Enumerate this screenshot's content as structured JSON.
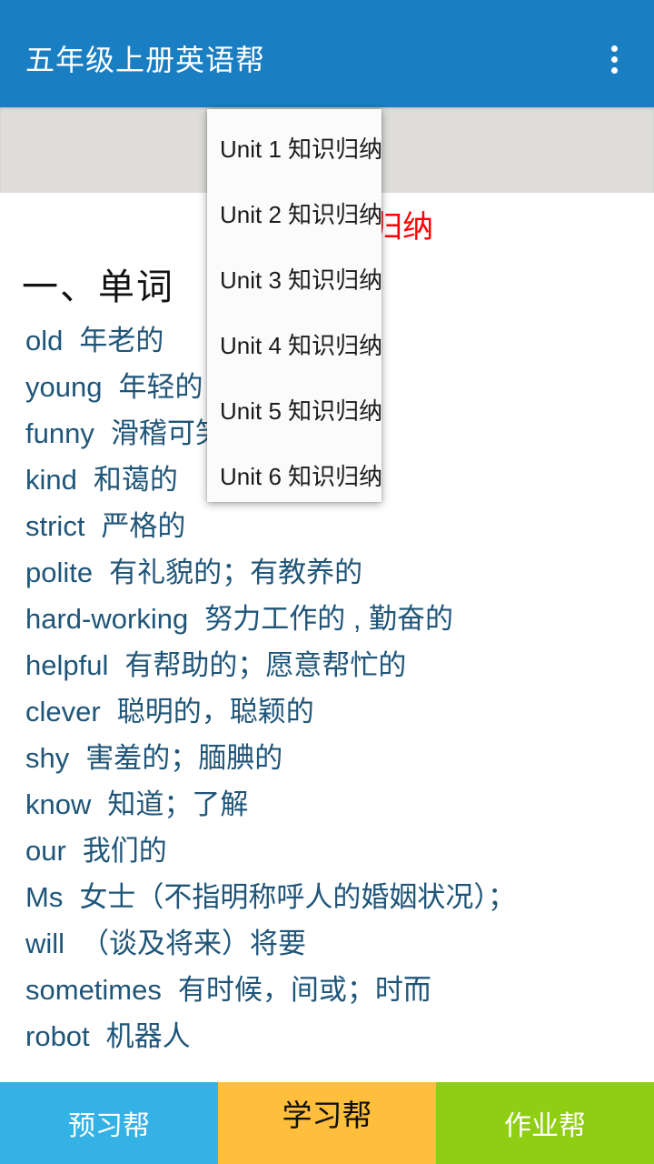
{
  "app_bar": {
    "title": "五年级上册英语帮",
    "overflow_icon": "more-vert-icon",
    "background_color": "#1a7ec2"
  },
  "spinner": {
    "caret_icon": "chevron-down-icon",
    "background_color": "#dedddb"
  },
  "dropdown": {
    "items": [
      {
        "label": "Unit 1 知识归纳"
      },
      {
        "label": "Unit 2 知识归纳"
      },
      {
        "label": "Unit 3 知识归纳"
      },
      {
        "label": "Unit 4 知识归纳"
      },
      {
        "label": "Unit 5 知识归纳"
      },
      {
        "label": "Unit 6 知识归纳"
      }
    ]
  },
  "content": {
    "doc_title": "Unit 1 知识归纳",
    "doc_title_color": "#ff0000",
    "section_heading": "一、单词",
    "body_color": "#1f5578",
    "words": [
      {
        "en": "old",
        "cn": "年老的"
      },
      {
        "en": "young",
        "cn": "年轻的"
      },
      {
        "en": "funny",
        "cn": "滑稽可笑的"
      },
      {
        "en": "kind",
        "cn": "和蔼的"
      },
      {
        "en": "strict",
        "cn": "严格的"
      },
      {
        "en": "polite",
        "cn": "有礼貌的；有教养的"
      },
      {
        "en": "hard-working",
        "cn": "努力工作的 , 勤奋的"
      },
      {
        "en": "helpful",
        "cn": "有帮助的；愿意帮忙的"
      },
      {
        "en": "clever",
        "cn": "聪明的，聪颖的"
      },
      {
        "en": "shy",
        "cn": "害羞的；腼腆的"
      },
      {
        "en": "know",
        "cn": "知道；了解"
      },
      {
        "en": "our",
        "cn": "我们的"
      },
      {
        "en": "Ms",
        "cn": "女士（不指明称呼人的婚姻状况）；"
      },
      {
        "en": "will",
        "cn": "（谈及将来）将要"
      },
      {
        "en": "sometimes",
        "cn": "有时候，间或；时而"
      },
      {
        "en": "robot",
        "cn": "机器人"
      }
    ]
  },
  "bottom_tabs": [
    {
      "label": "预习帮",
      "color": "#35b2e5",
      "selected": false
    },
    {
      "label": "学习帮",
      "color": "#ffbf3c",
      "selected": true
    },
    {
      "label": "作业帮",
      "color": "#8fce12",
      "selected": false
    }
  ]
}
